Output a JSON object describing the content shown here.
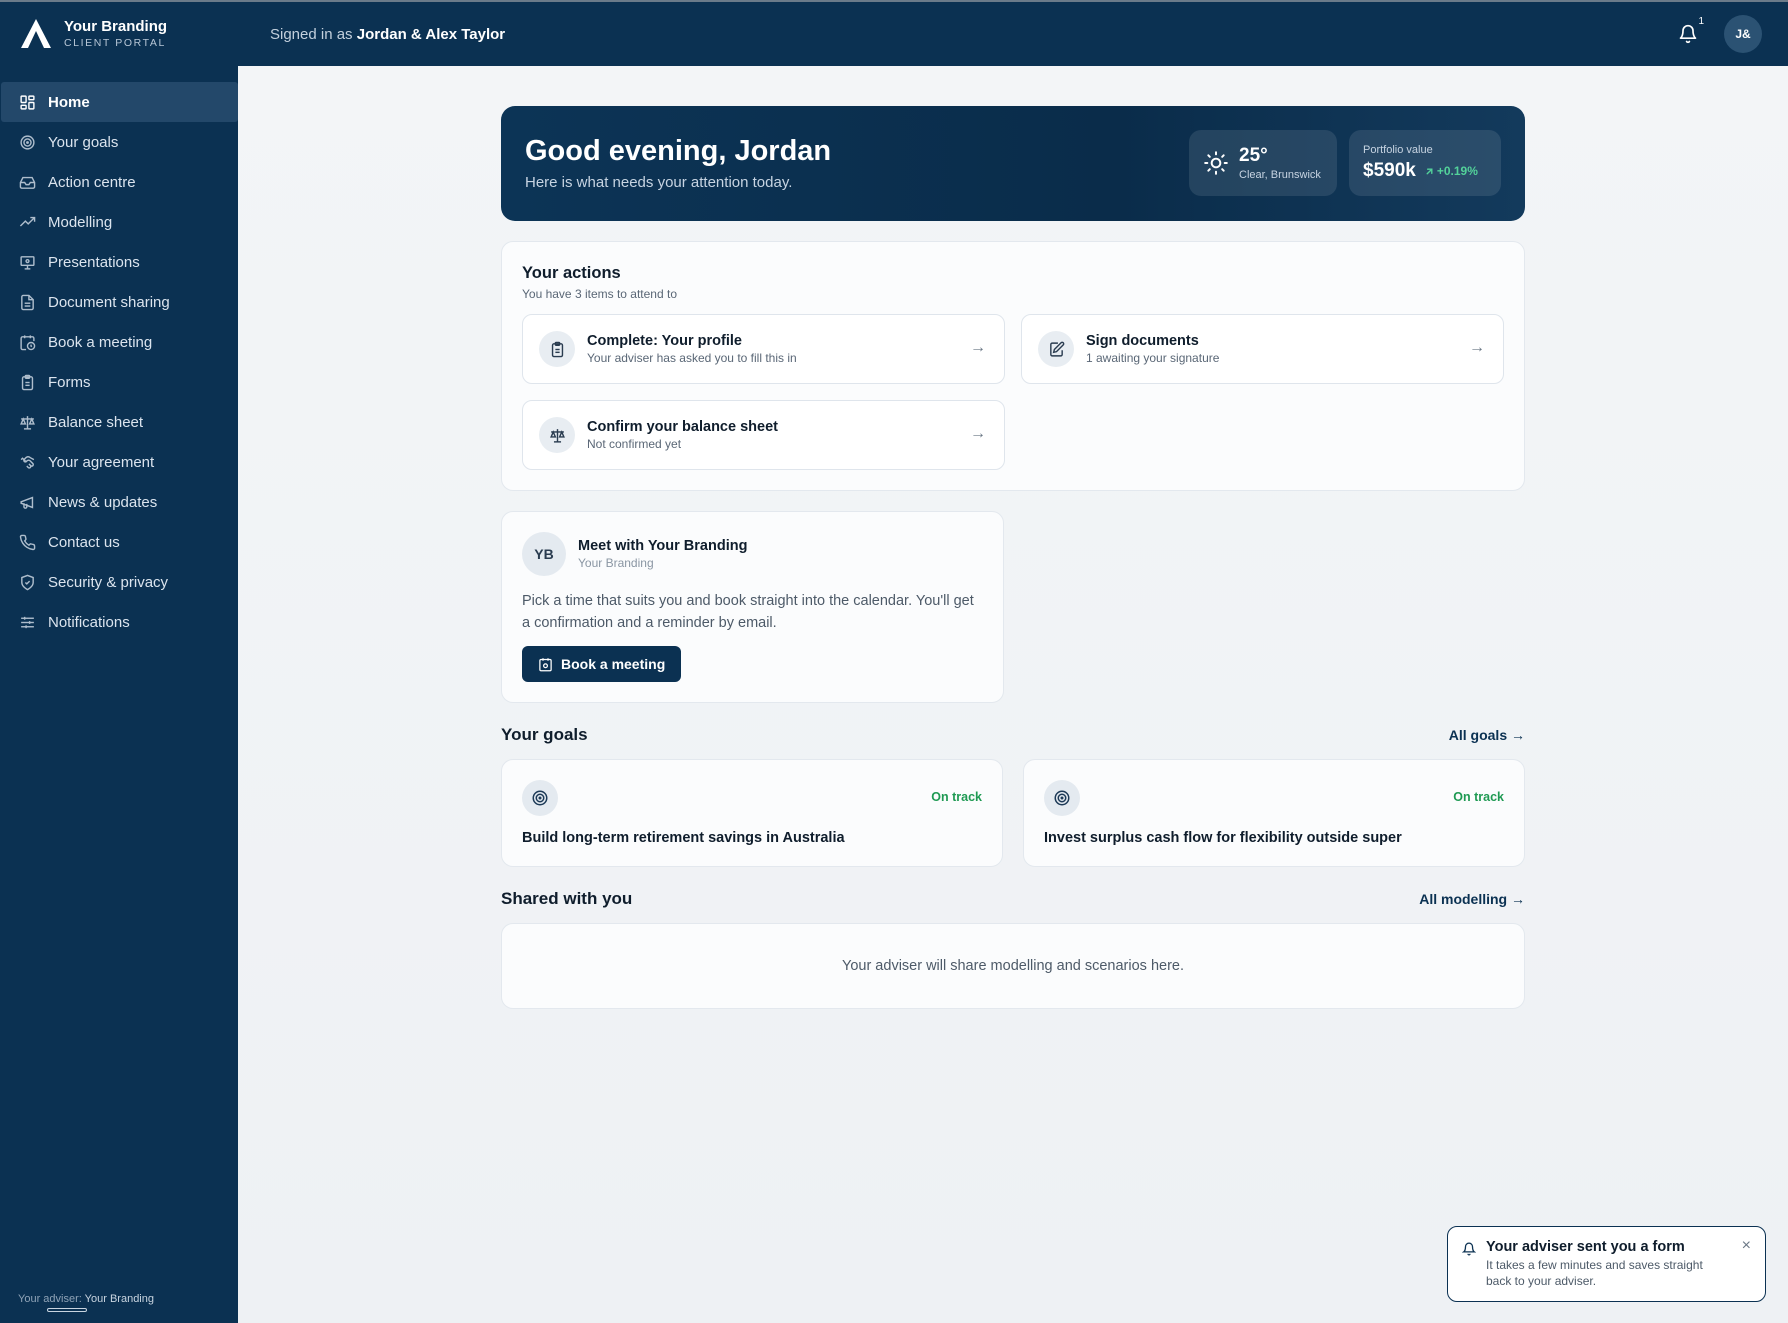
{
  "brand": {
    "name": "Your Branding",
    "sub": "CLIENT PORTAL"
  },
  "header": {
    "signed_in_prefix": "Signed in as",
    "user_name": "Jordan & Alex Taylor",
    "notification_count": "1",
    "avatar_initials": "J&"
  },
  "sidebar": {
    "items": [
      {
        "label": "Home",
        "icon": "grid-icon"
      },
      {
        "label": "Your goals",
        "icon": "target-icon"
      },
      {
        "label": "Action centre",
        "icon": "inbox-icon"
      },
      {
        "label": "Modelling",
        "icon": "trend-icon"
      },
      {
        "label": "Presentations",
        "icon": "presentation-icon"
      },
      {
        "label": "Document sharing",
        "icon": "document-icon"
      },
      {
        "label": "Book a meeting",
        "icon": "calendar-clock-icon"
      },
      {
        "label": "Forms",
        "icon": "clipboard-icon"
      },
      {
        "label": "Balance sheet",
        "icon": "scale-icon"
      },
      {
        "label": "Your agreement",
        "icon": "handshake-icon"
      },
      {
        "label": "News & updates",
        "icon": "megaphone-icon"
      },
      {
        "label": "Contact us",
        "icon": "phone-icon"
      },
      {
        "label": "Security & privacy",
        "icon": "shield-icon"
      },
      {
        "label": "Notifications",
        "icon": "sliders-icon"
      }
    ],
    "footer_label": "Your adviser:",
    "footer_value": "Your Branding"
  },
  "hero": {
    "greeting": "Good evening, Jordan",
    "subtitle": "Here is what needs your attention today.",
    "weather_temp": "25°",
    "weather_location": "Clear, Brunswick",
    "portfolio_label": "Portfolio value",
    "portfolio_value": "$590k",
    "portfolio_change": "+0.19%"
  },
  "actions": {
    "title": "Your actions",
    "subtitle": "You have 3 items to attend to",
    "items": [
      {
        "title": "Complete: Your profile",
        "sub": "Your adviser has asked you to fill this in"
      },
      {
        "title": "Sign documents",
        "sub": "1 awaiting your signature"
      },
      {
        "title": "Confirm your balance sheet",
        "sub": "Not confirmed yet"
      }
    ]
  },
  "meeting": {
    "initials": "YB",
    "title": "Meet with Your Branding",
    "sub": "Your Branding",
    "text": "Pick a time that suits you and book straight into the calendar. You'll get a confirmation and a reminder by email.",
    "button": "Book a meeting"
  },
  "goals": {
    "title": "Your goals",
    "link": "All goals →",
    "items": [
      {
        "status": "On track",
        "title": "Build long-term retirement savings in Australia"
      },
      {
        "status": "On track",
        "title": "Invest surplus cash flow for flexibility outside super"
      }
    ]
  },
  "shared": {
    "title": "Shared with you",
    "link": "All modelling →",
    "empty": "Your adviser will share modelling and scenarios here."
  },
  "toast": {
    "title": "Your adviser sent you a form",
    "text": "It takes a few minutes and saves straight back to your adviser."
  },
  "colors": {
    "primary": "#0b3152",
    "success": "#1f9a53",
    "positive": "#53d29a"
  }
}
